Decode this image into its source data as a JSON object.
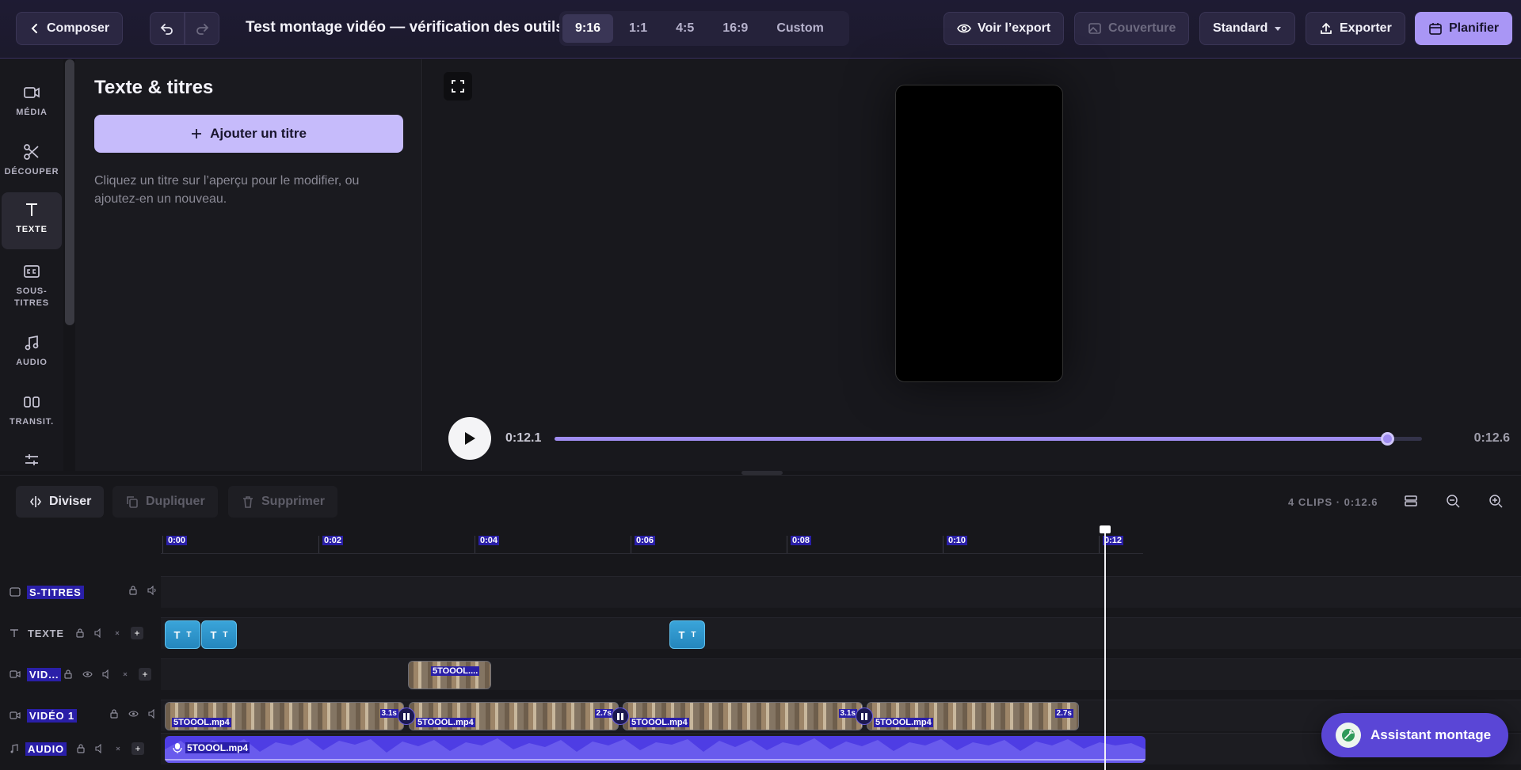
{
  "topbar": {
    "back_label": "Composer",
    "project_title": "Test montage vidéo — vérification des outils.",
    "ratios": [
      "9:16",
      "1:1",
      "4:5",
      "16:9",
      "Custom"
    ],
    "active_ratio": "9:16",
    "view_export_label": "Voir l’export",
    "cover_label": "Couverture",
    "quality_label": "Standard",
    "export_label": "Exporter",
    "schedule_label": "Planifier"
  },
  "rail": {
    "items": [
      {
        "label": "MÉDIA",
        "icon": "video-icon"
      },
      {
        "label": "DÉCOUPER",
        "icon": "scissors-icon"
      },
      {
        "label": "TEXTE",
        "icon": "text-icon"
      },
      {
        "label": "SOUS-TITRES",
        "icon": "captions-icon"
      },
      {
        "label": "AUDIO",
        "icon": "music-icon"
      },
      {
        "label": "TRANSIT.",
        "icon": "transition-icon"
      }
    ]
  },
  "panel": {
    "title": "Texte & titres",
    "add_button": "Ajouter un titre",
    "hint": "Cliquez un titre sur l’aperçu pour le modifier, ou ajoutez-en un nouveau."
  },
  "preview": {
    "current_time": "0:12.1",
    "total_time": "0:12.6",
    "progress": 0.96
  },
  "timeline_toolbar": {
    "split_label": "Diviser",
    "duplicate_label": "Dupliquer",
    "delete_label": "Supprimer",
    "clips_summary": "4 CLIPS · 0:12.6"
  },
  "timeline": {
    "ticks": [
      "0:00",
      "0:02",
      "0:04",
      "0:06",
      "0:08",
      "0:10",
      "0:12"
    ],
    "tracks": {
      "subtitles": "S-TITRES",
      "text": "TEXTE",
      "video2": "VID...",
      "video1": "VIDÉO 1",
      "audio": "AUDIO"
    },
    "text_clip_glyph": "T",
    "overlay_clip_label": "5TOOOL....",
    "video_clips": [
      {
        "label": "5TOOOL.mp4",
        "duration": "3.1s"
      },
      {
        "label": "5TOOOL.mp4",
        "duration": "2.7s"
      },
      {
        "label": "5TOOOL.mp4",
        "duration": "3.1s"
      },
      {
        "label": "5TOOOL.mp4",
        "duration": "2.7s"
      }
    ],
    "audio_clip_label": "5TOOOL.mp4"
  },
  "assistant": {
    "label": "Assistant montage"
  },
  "colors": {
    "accent": "#a996f5",
    "audio": "#4e3de4",
    "text_clip": "#2486bd"
  }
}
